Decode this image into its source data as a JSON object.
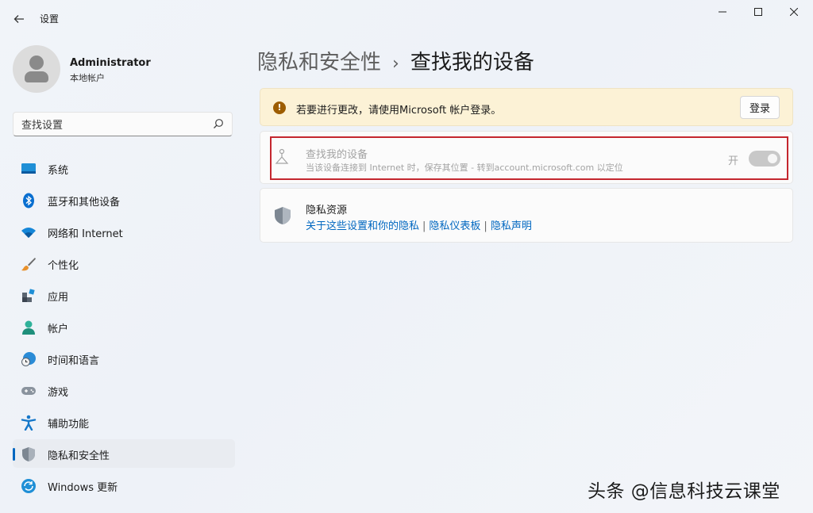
{
  "titlebar": {
    "app_title": "设置",
    "back_icon": "arrow-left-icon",
    "window_controls": [
      "minimize-icon",
      "maximize-icon",
      "close-icon"
    ]
  },
  "profile": {
    "name": "Administrator",
    "account_type": "本地帐户"
  },
  "search": {
    "placeholder": "查找设置"
  },
  "sidebar": {
    "items": [
      {
        "label": "系统",
        "icon": "display-icon"
      },
      {
        "label": "蓝牙和其他设备",
        "icon": "bluetooth-icon"
      },
      {
        "label": "网络和 Internet",
        "icon": "wifi-icon"
      },
      {
        "label": "个性化",
        "icon": "brush-icon"
      },
      {
        "label": "应用",
        "icon": "apps-icon"
      },
      {
        "label": "帐户",
        "icon": "person-icon"
      },
      {
        "label": "时间和语言",
        "icon": "globe-clock-icon"
      },
      {
        "label": "游戏",
        "icon": "gamepad-icon"
      },
      {
        "label": "辅助功能",
        "icon": "accessibility-icon"
      },
      {
        "label": "隐私和安全性",
        "icon": "shield-icon",
        "selected": true
      },
      {
        "label": "Windows 更新",
        "icon": "update-icon"
      }
    ]
  },
  "breadcrumb": {
    "parent": "隐私和安全性",
    "separator": "›",
    "current": "查找我的设备"
  },
  "banner": {
    "message": "若要进行更改，请使用Microsoft 帐户登录。",
    "button_label": "登录",
    "icon": "warning-icon"
  },
  "find_device": {
    "title": "查找我的设备",
    "description": "当该设备连接到 Internet 时，保存其位置 - 转到account.microsoft.com 以定位",
    "toggle_label": "开",
    "toggle_on": true,
    "enabled": false
  },
  "privacy_resources": {
    "title": "隐私资源",
    "links": [
      "关于这些设置和你的隐私",
      "隐私仪表板",
      "隐私声明"
    ],
    "divider": "|"
  },
  "watermark": "头条 @信息科技云课堂",
  "colors": {
    "accent": "#0067c0",
    "highlight_border": "#c4262e",
    "banner_bg": "#fcf2d6",
    "warning": "#9d5d00"
  }
}
